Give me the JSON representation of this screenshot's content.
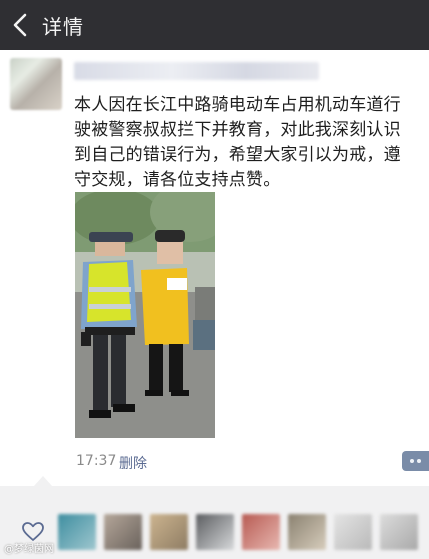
{
  "header": {
    "title": "详情",
    "back_icon": "chevron-left-icon"
  },
  "post": {
    "text": "本人因在长江中路骑电动车占用机动车道行驶被警察叔叔拦下并教育，对此我深刻认识到自己的错误行为，希望大家引以为戒，遵守交规，请各位支持点赞。",
    "time": "17:37",
    "delete_label": "删除",
    "more_icon": "more-dots-icon"
  },
  "likes": {
    "icon": "heart-outline-icon"
  },
  "watermark": {
    "text": "@梦绿茵网"
  },
  "colors": {
    "topbar": "#2f2f33",
    "link": "#5b6b92",
    "like_bg": "#f1f1f2"
  }
}
